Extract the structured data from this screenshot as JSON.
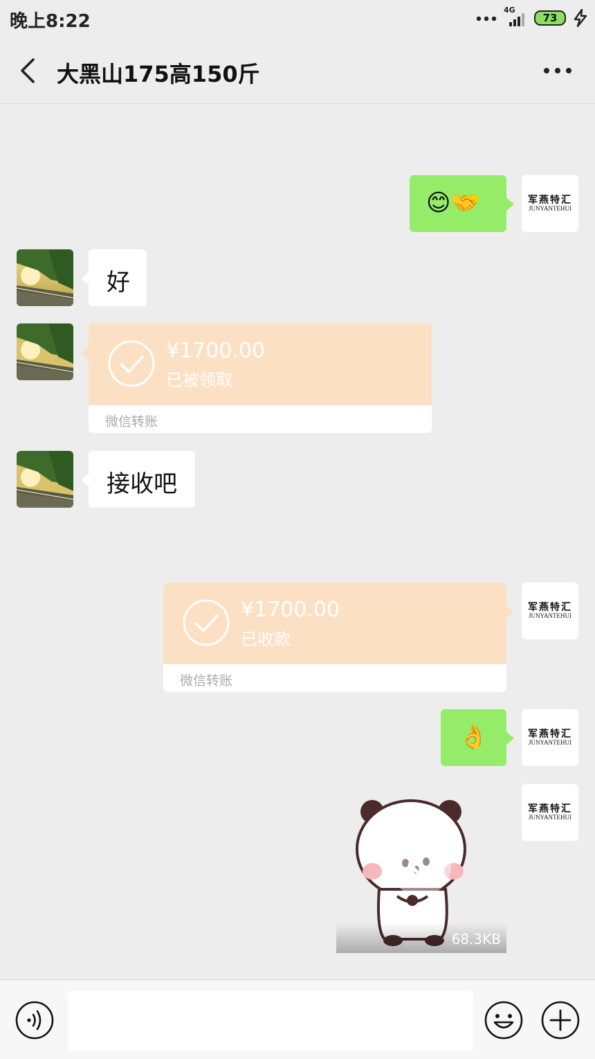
{
  "status_bar": {
    "time": "晚上8:22",
    "network": "4G",
    "battery": "73"
  },
  "nav": {
    "title": "大黑山175高150斤"
  },
  "avatar_me": {
    "cn": "军燕特汇",
    "en": "JUNYANTEHUI"
  },
  "messages": [
    {
      "from": "me",
      "type": "emoji",
      "content": "😊🤝"
    },
    {
      "from": "other",
      "type": "text",
      "text": "好"
    },
    {
      "from": "other",
      "type": "transfer",
      "amount": "¥1700.00",
      "status": "已被领取",
      "label": "微信转账"
    },
    {
      "from": "other",
      "type": "text",
      "text": "接收吧"
    },
    {
      "from": "me",
      "type": "transfer",
      "amount": "¥1700.00",
      "status": "已收款",
      "label": "微信转账"
    },
    {
      "from": "me",
      "type": "emoji",
      "content": "👌"
    },
    {
      "from": "me",
      "type": "sticker",
      "file_size": "68.3KB"
    }
  ],
  "colors": {
    "background": "#ededed",
    "my_bubble": "#95ec69",
    "their_bubble": "#ffffff",
    "transfer_card": "#fce0c4"
  }
}
